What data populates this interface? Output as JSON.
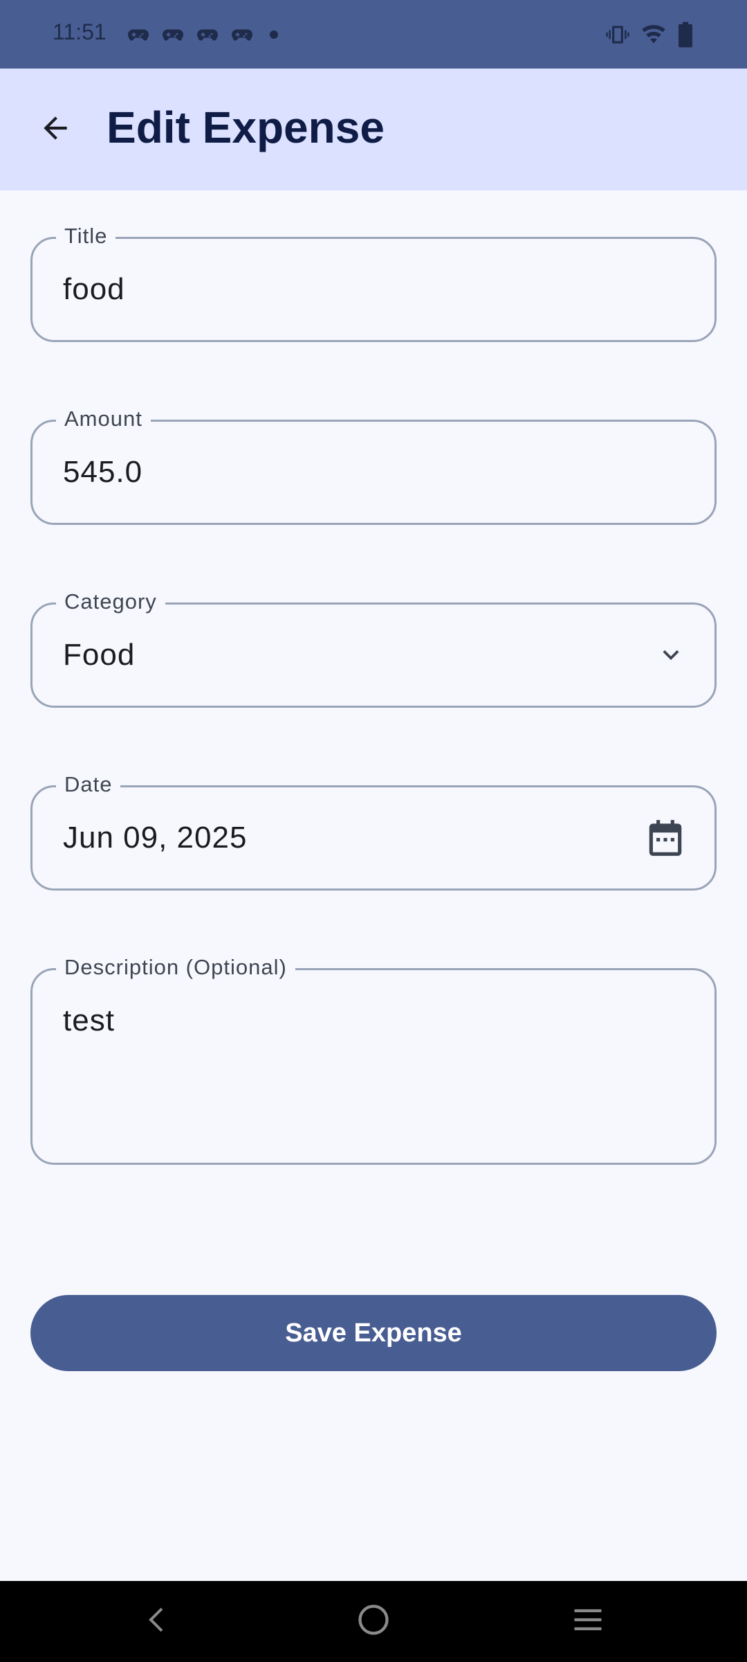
{
  "status_bar": {
    "time": "11:51",
    "notification_icons": [
      "game-controller-icon",
      "game-controller-icon",
      "game-controller-icon",
      "game-controller-icon"
    ],
    "system_icons": [
      "vibrate-icon",
      "wifi-icon",
      "battery-icon"
    ]
  },
  "app_bar": {
    "title": "Edit Expense",
    "back_icon": "arrow-left-icon"
  },
  "form": {
    "title": {
      "label": "Title",
      "value": "food"
    },
    "amount": {
      "label": "Amount",
      "value": "545.0"
    },
    "category": {
      "label": "Category",
      "value": "Food",
      "trailing_icon": "chevron-down-icon"
    },
    "date": {
      "label": "Date",
      "value": "Jun 09, 2025",
      "trailing_icon": "calendar-icon"
    },
    "description": {
      "label": "Description (Optional)",
      "value": "test"
    }
  },
  "actions": {
    "save_label": "Save Expense"
  },
  "colors": {
    "primary": "#485d92",
    "app_bar_bg": "#dbe1ff",
    "surface": "#f7f8fd",
    "outline": "#9aa4b8"
  }
}
